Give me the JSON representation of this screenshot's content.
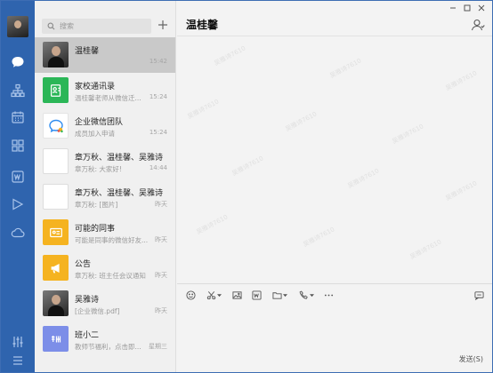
{
  "search": {
    "placeholder": "搜索"
  },
  "chat": {
    "title": "温桂馨",
    "send_label": "发送(S)",
    "watermark": "吴雅诗7610"
  },
  "conversations": [
    {
      "name": "温桂馨",
      "preview": "",
      "time": "15:42"
    },
    {
      "name": "家校通讯录",
      "preview": "温桂馨老师从微信迁...",
      "time": "15:24"
    },
    {
      "name": "企业微信团队",
      "preview": "成员加入申请",
      "time": "15:24"
    },
    {
      "name": "章万秋、温桂馨、吴雅诗",
      "preview": "章万秋: 大家好!",
      "time": "14:44"
    },
    {
      "name": "章万秋、温桂馨、吴雅诗",
      "preview": "章万秋: [图片]",
      "time": "昨天"
    },
    {
      "name": "可能的同事",
      "preview": "可能是同事的微信好友...",
      "time": "昨天"
    },
    {
      "name": "公告",
      "preview": "章万秋: 班主任会议通知",
      "time": "昨天"
    },
    {
      "name": "吴雅诗",
      "preview": "[企业微信.pdf]",
      "time": "昨天"
    },
    {
      "name": "班小二",
      "preview": "教师节福利，点击即...",
      "time": "星期三"
    }
  ],
  "colors": {
    "rail": "#2f64ae",
    "active_row": "#c9c9c9",
    "green": "#2bb657",
    "yellow": "#f5b320",
    "purple": "#7c8ee8"
  }
}
